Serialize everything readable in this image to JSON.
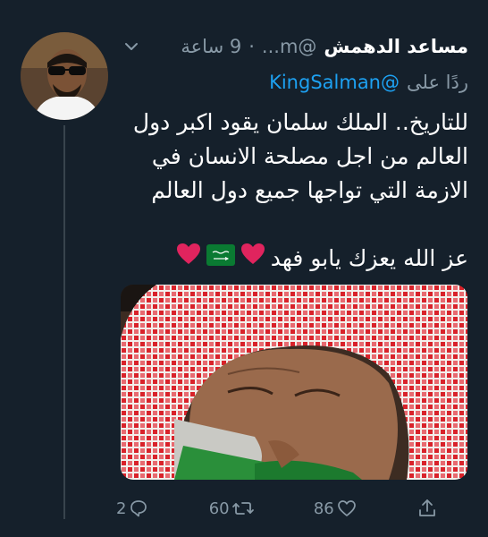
{
  "tweet": {
    "display_name": "مساعد الدهمش",
    "handle": "@m...",
    "time": "9 ساعة",
    "reply_prefix": "ردًا على",
    "reply_to": "@KingSalman",
    "text_lines": [
      "للتاريخ.. الملك سلمان يقود اكبر دول",
      "العالم من اجل مصلحة الانسان في",
      "الازمة التي تواجها جميع دول العالم"
    ],
    "text_second": "عز الله يعزك يابو فهد",
    "flag_text": "لا إله إلا الله"
  },
  "actions": {
    "replies": "2",
    "retweets": "60",
    "likes": "86"
  },
  "colors": {
    "background": "#15202b",
    "muted": "#8899a6",
    "link": "#1da1f2",
    "heart": "#e0245e"
  },
  "icons": [
    "chevron-down-icon",
    "reply-icon",
    "retweet-icon",
    "like-icon",
    "share-icon",
    "heart-emoji-icon",
    "saudi-flag-icon"
  ]
}
